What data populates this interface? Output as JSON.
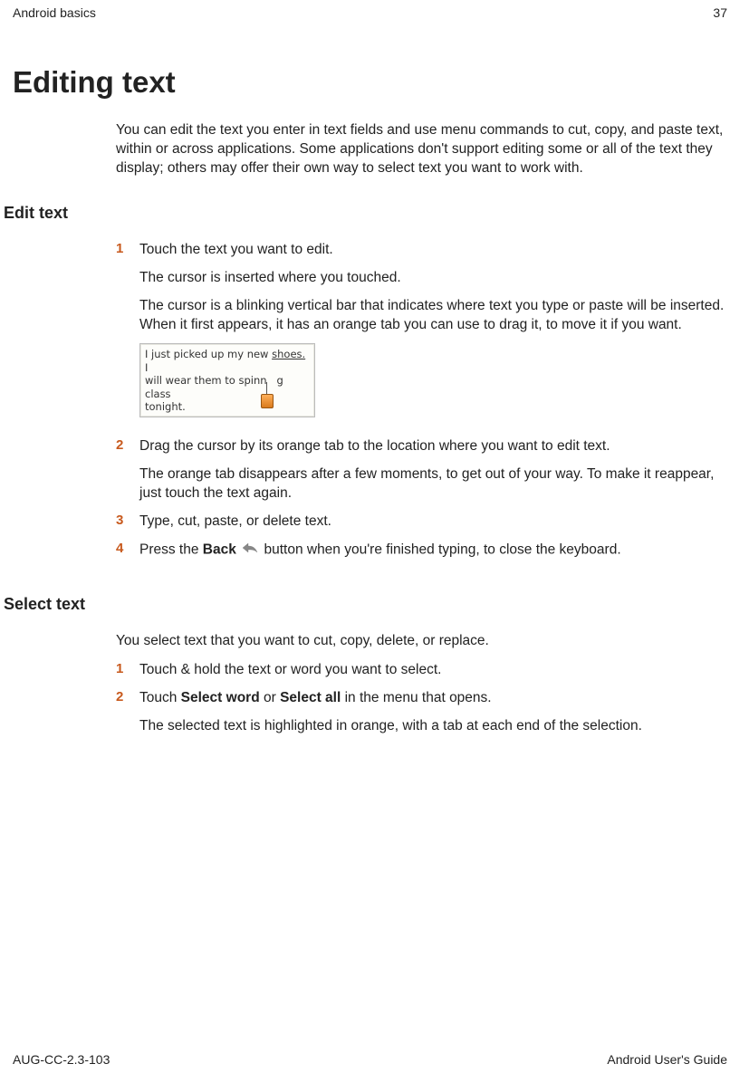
{
  "header": {
    "left": "Android basics",
    "right": "37"
  },
  "title": "Editing text",
  "intro": "You can edit the text you enter in text fields and use menu commands to cut, copy, and paste text, within or across applications. Some applications don't support editing some or all of the text they display; others may offer their own way to select text you want to work with.",
  "section1": {
    "heading": "Edit text",
    "steps": {
      "s1": {
        "num": "1",
        "p1": "Touch the text you want to edit.",
        "p2": "The cursor is inserted where you touched.",
        "p3": "The cursor is a blinking vertical bar that indicates where text you type or paste will be inserted. When it first appears, it has an orange tab you can use to drag it, to move it if you want."
      },
      "screenshot": {
        "line1a": "I just picked up my new ",
        "line1b": "shoes.",
        "line1c": " I",
        "line2a": "will wear them to spinn",
        "line2b": "g class",
        "line3": "tonight."
      },
      "s2": {
        "num": "2",
        "p1": "Drag the cursor by its orange tab to the location where you want to edit text.",
        "p2": "The orange tab disappears after a few moments, to get out of your way. To make it reappear, just touch the text again."
      },
      "s3": {
        "num": "3",
        "p1": "Type, cut, paste, or delete text."
      },
      "s4": {
        "num": "4",
        "p1a": "Press the ",
        "p1b": "Back",
        "p1c": " button when you're finished typing, to close the keyboard."
      }
    }
  },
  "section2": {
    "heading": "Select text",
    "intro": "You select text that you want to cut, copy, delete, or replace.",
    "steps": {
      "s1": {
        "num": "1",
        "p1": "Touch & hold the text or word you want to select."
      },
      "s2": {
        "num": "2",
        "p1a": "Touch ",
        "p1b": "Select word",
        "p1c": " or ",
        "p1d": "Select all",
        "p1e": " in the menu that opens.",
        "p2": "The selected text is highlighted in orange, with a tab at each end of the selection."
      }
    }
  },
  "footer": {
    "left": "AUG-CC-2.3-103",
    "right": "Android User's Guide"
  }
}
